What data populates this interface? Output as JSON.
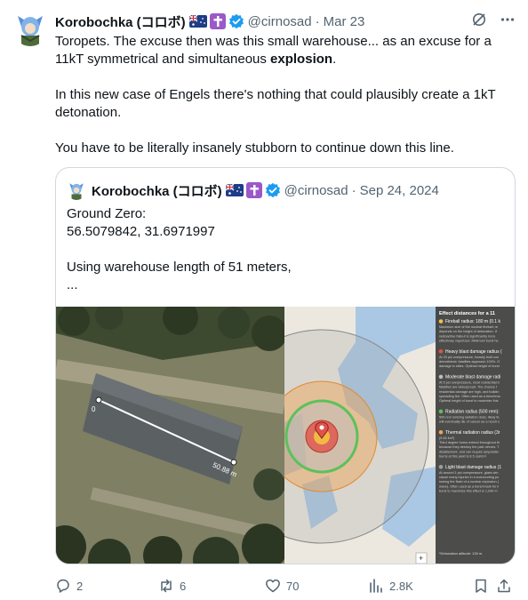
{
  "tweet": {
    "author_name": "Korobochka (コロボ)",
    "handle": "@cirnosad",
    "separator": "·",
    "date": "Mar 23",
    "paragraphs": [
      {
        "before": "Toropets. The excuse then was this small warehouse... as an excuse for a 11kT symmetrical and simultaneous ",
        "bold": "explosion",
        "after": "."
      },
      {
        "text": "In this new case of Engels there's nothing that could plausibly create a 1kT detonation."
      },
      {
        "text": "You have to be literally insanely stubborn to continue down this line."
      }
    ]
  },
  "quote": {
    "author_name": "Korobochka (コロボ)",
    "handle": "@cirnosad",
    "separator": "·",
    "date": "Sep 24, 2024",
    "lines": [
      "Ground Zero:",
      "56.5079842, 31.6971997",
      "",
      "Using warehouse length of 51 meters,",
      "..."
    ],
    "image_left": {
      "label_start": "0",
      "label_end": "50.88 m"
    },
    "image_right": {
      "panel_title": "Effect distances for a 11",
      "items": [
        {
          "label": "Fireball radius: 180 m (0.1 k",
          "color": "#f5c242",
          "desc": [
            "Maximum size of the nuclear fireball; re",
            "depends on the height of detonation. If",
            "radioactive fallout is significantly incre",
            "effectively vaporized. Minimum burst he"
          ]
        },
        {
          "label": "Heavy blast damage radius (",
          "color": "#e0524a",
          "desc": [
            "At 20 psi overpressure, heavily built con",
            "demolished; fatalities approach 100%. O",
            "damage in cities. Optimal height of burst"
          ]
        },
        {
          "label": "Moderate blast damage radi",
          "color": "#bdbdbd",
          "desc": [
            "At 5 psi overpressure, most residential b",
            "fatalities are widespread. The chance t",
            "residential damage are high, and buildin",
            "spreading fire. Often used as a benchma",
            "Optimal height of burst to maximize this"
          ]
        },
        {
          "label": "Radiation radius (500 rem):",
          "color": "#5cc15a",
          "desc": [
            "500 rem ionizing radiation dose; likely fa",
            "will eventually die of cancer as a result o"
          ]
        },
        {
          "label": "Thermal radiation radius (3r",
          "color": "#f0a452",
          "desc": [
            "(9.48 km²)",
            "Third degree burns extend throughout th",
            "because they destroy the pain nerves. T",
            "disablement, and can require amputatio",
            "burns at this yield is 8.5 cal/cm²."
          ]
        },
        {
          "label": "Light blast damage radius (1",
          "color": "#9e9e9e",
          "desc": [
            "At around 1 psi overpressure, glass win",
            "cause many injuries in a surrounding po",
            "seeing the flash of a nuclear explosion (",
            "wave). Often used as a benchmark for li",
            "burst to maximize this effect is 1,040 m"
          ]
        }
      ],
      "footnote": "*Detonation altitude: 130 m.",
      "zoom_label": "+"
    }
  },
  "actions": {
    "replies": "2",
    "reposts": "6",
    "likes": "70",
    "views": "2.8K"
  },
  "colors": {
    "verified": "#1d9bf0",
    "muted": "#536471",
    "border": "#cfd9de"
  }
}
